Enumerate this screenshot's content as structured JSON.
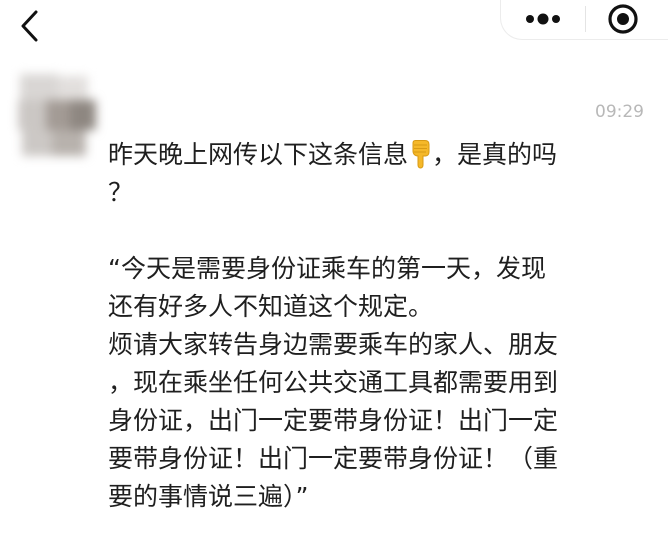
{
  "nav": {
    "back_icon": "chevron-left-icon",
    "more_icon": "more-dots-icon",
    "close_icon": "target-close-icon"
  },
  "message": {
    "time": "09:29",
    "line1_before_emoji": "昨天晚上网传以下这条信息",
    "emoji": "pointing-down-hand-emoji",
    "line1_after_emoji": "，是真的吗",
    "line2": "？",
    "quote_lines": [
      "“今天是需要身份证乘车的第一天，发现",
      "还有好多人不知道这个规定。",
      "烦请大家转告身边需要乘车的家人、朋友",
      "，现在乘坐任何公共交通工具都需要用到",
      "身份证，出门一定要带身份证！出门一定",
      "要带身份证！出门一定要带身份证！（重",
      "要的事情说三遍）”"
    ]
  },
  "colors": {
    "text": "#1f1f1f",
    "timestamp": "#b8b8b8",
    "emoji": "#f5b829"
  }
}
